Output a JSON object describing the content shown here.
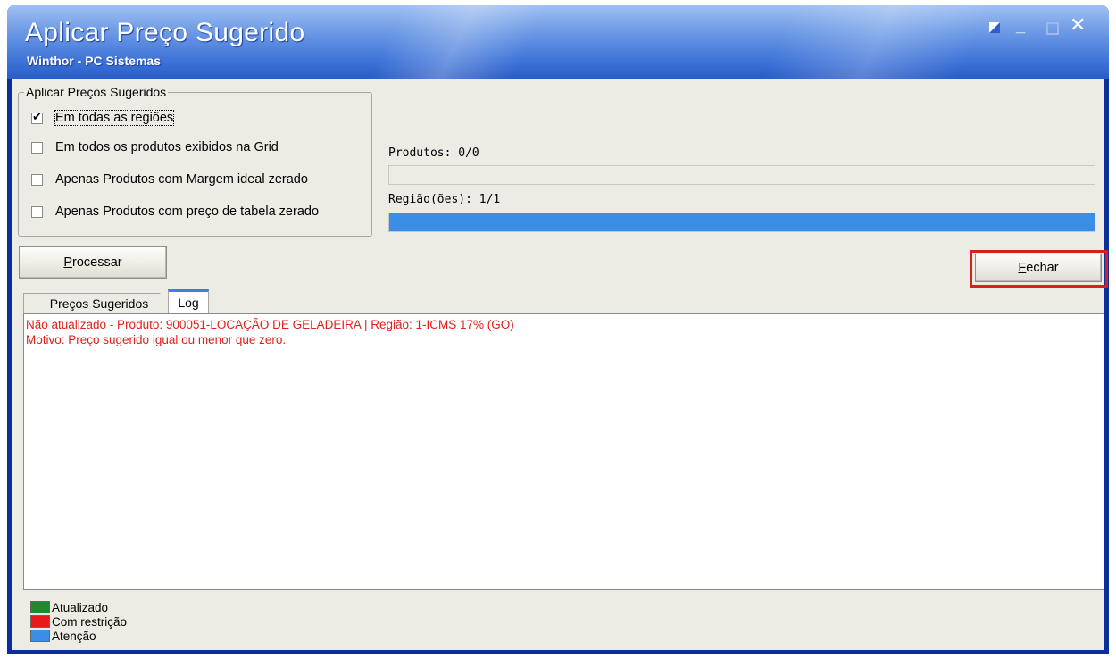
{
  "window": {
    "title": "Aplicar Preço Sugerido",
    "subtitle": "Winthor - PC Sistemas",
    "minimize_glyph": "_",
    "close_glyph": "✕"
  },
  "options_group": {
    "legend": "Aplicar Preços Sugeridos",
    "items": [
      {
        "label": "Em todas as regiões",
        "checked": true
      },
      {
        "label": "Em todos os produtos exibidos na Grid",
        "checked": false
      },
      {
        "label": "Apenas Produtos com Margem ideal zerado",
        "checked": false
      },
      {
        "label": "Apenas Produtos com preço de tabela zerado",
        "checked": false
      }
    ]
  },
  "progress": {
    "produtos_label": "Produtos: 0/0",
    "produtos_fraction": 0,
    "regioes_label": "Região(ões): 1/1",
    "regioes_fraction": 1
  },
  "buttons": {
    "processar": {
      "mnemonic": "P",
      "rest": "rocessar"
    },
    "fechar": {
      "mnemonic": "F",
      "rest": "echar"
    }
  },
  "tabs": [
    "Preços Sugeridos",
    "Log"
  ],
  "log": [
    "Não atualizado - Produto: 900051-LOCAÇÃO DE GELADEIRA | Região: 1-ICMS 17% (GO)",
    "Motivo: Preço sugerido igual ou menor que zero."
  ],
  "legend": [
    {
      "label": "Atualizado",
      "color": "#1e8a2e"
    },
    {
      "label": "Com restrição",
      "color": "#e8191a"
    },
    {
      "label": "Atenção",
      "color": "#3a8ee8"
    }
  ],
  "colors": {
    "log_text": "#e0201a",
    "highlight": "#d6201e",
    "progress_fill": "#3a8ee8"
  }
}
